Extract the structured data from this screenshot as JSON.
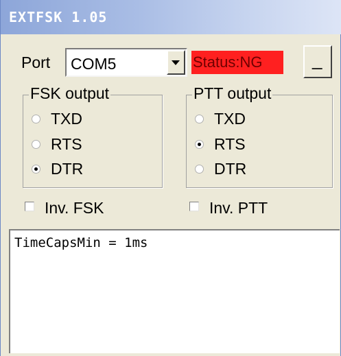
{
  "window": {
    "title": "EXTFSK 1.05"
  },
  "port": {
    "label": "Port",
    "selected": "COM5"
  },
  "status": {
    "text": "Status:NG",
    "color": "#ff2020"
  },
  "minimize": {
    "label": "_"
  },
  "fsk_output": {
    "title": "FSK output",
    "options": [
      {
        "label": "TXD",
        "selected": false
      },
      {
        "label": "RTS",
        "selected": false
      },
      {
        "label": "DTR",
        "selected": true
      }
    ]
  },
  "ptt_output": {
    "title": "PTT output",
    "options": [
      {
        "label": "TXD",
        "selected": false
      },
      {
        "label": "RTS",
        "selected": true
      },
      {
        "label": "DTR",
        "selected": false
      }
    ]
  },
  "checkboxes": {
    "inv_fsk": {
      "label": "Inv. FSK",
      "checked": false
    },
    "inv_ptt": {
      "label": "Inv. PTT",
      "checked": false
    }
  },
  "log": {
    "lines": [
      "TimeCapsMin = 1ms"
    ]
  }
}
